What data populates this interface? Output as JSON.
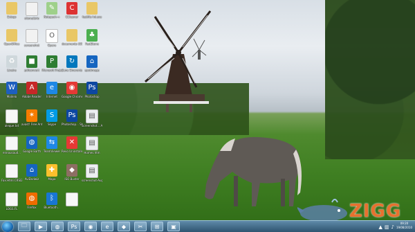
{
  "desktop": {
    "icons": [
      {
        "label": "Extrgo",
        "icon": "folder-icon"
      },
      {
        "label": "cfomulário",
        "icon": "document-icon"
      },
      {
        "label": "Notepad++",
        "icon": "notepad-icon"
      },
      {
        "label": "CCleaner",
        "icon": "ccleaner-icon"
      },
      {
        "label": "fastfile hd.exe",
        "icon": "folder-icon"
      },
      {
        "label": "OpenOffice",
        "icon": "folder-icon"
      },
      {
        "label": "screenshot",
        "icon": "document-icon"
      },
      {
        "label": "Opera",
        "icon": "opera-icon"
      },
      {
        "label": "documento (OSLSV-DO)",
        "icon": "folder-icon"
      },
      {
        "label": "FastStone",
        "icon": "tree-icon"
      },
      {
        "label": "Lixeira",
        "icon": "recycle-bin-icon"
      },
      {
        "label": "pdfconvert",
        "icon": "green-app-icon"
      },
      {
        "label": "Microsoft Project 2010",
        "icon": "project-icon"
      },
      {
        "label": "Zune Sincronizar",
        "icon": "sync-icon"
      },
      {
        "label": "spotimage",
        "icon": "network-icon"
      },
      {
        "label": "Modelo",
        "icon": "word-icon"
      },
      {
        "label": "Adobe Reader",
        "icon": "pdf-icon"
      },
      {
        "label": "Internet",
        "icon": "ie-icon"
      },
      {
        "label": "Google Chrome",
        "icon": "chrome-icon"
      },
      {
        "label": "Photoshop",
        "icon": "photoshop-icon"
      },
      {
        "label": "aleque.txt",
        "icon": "text-file-icon"
      },
      {
        "label": "avast! Free Antivirus",
        "icon": "avast-icon"
      },
      {
        "label": "Skype",
        "icon": "skype-icon"
      },
      {
        "label": "Photoshop... Studio",
        "icon": "photoshop-icon"
      },
      {
        "label": "Screenshot... Aug 19 08...",
        "icon": "image-icon"
      },
      {
        "label": "ennousaud...",
        "icon": "text-file-icon"
      },
      {
        "label": "Google Earth",
        "icon": "earth-icon"
      },
      {
        "label": "TeamViewer",
        "icon": "teamviewer-icon"
      },
      {
        "label": "Revo Uninstaller",
        "icon": "uninstaller-icon"
      },
      {
        "label": "Homes.htm",
        "icon": "image-icon"
      },
      {
        "label": "Fax.Html CRSI2006.htm",
        "icon": "text-file-icon"
      },
      {
        "label": "AviDvdwiz",
        "icon": "network-icon"
      },
      {
        "label": "Mapa",
        "icon": "puzzle-icon"
      },
      {
        "label": "ISO Buster",
        "icon": "dragon-icon"
      },
      {
        "label": "screenshot-Aug 19...",
        "icon": "image-icon"
      },
      {
        "label": "LOGS.FL",
        "icon": "text-file-icon"
      },
      {
        "label": "Firefox",
        "icon": "firefox-icon"
      },
      {
        "label": "Bluetooth...",
        "icon": "bluetooth-icon"
      },
      {
        "label": "",
        "icon": "blank-file-icon"
      }
    ]
  },
  "watermark": {
    "text": "ZIGG"
  },
  "taskbar": {
    "items": [
      {
        "name": "explorer",
        "glyph": "🗀"
      },
      {
        "name": "media-player",
        "glyph": "▶"
      },
      {
        "name": "firefox",
        "glyph": "◍"
      },
      {
        "name": "photoshop",
        "glyph": "Ps"
      },
      {
        "name": "chrome",
        "glyph": "◉"
      },
      {
        "name": "internet-explorer",
        "glyph": "e"
      },
      {
        "name": "utility",
        "glyph": "◆"
      },
      {
        "name": "snipping-tool",
        "glyph": "✂"
      },
      {
        "name": "network",
        "glyph": "⊞"
      },
      {
        "name": "screenshot-app",
        "glyph": "▣"
      }
    ],
    "clock_time": "09:20",
    "clock_date": "19/08/2010"
  },
  "colors": {
    "sky": "#d8dfe6",
    "grass": "#3f7f22",
    "taskbar": "#3b6584",
    "zigg_orange": "#e7712f"
  }
}
